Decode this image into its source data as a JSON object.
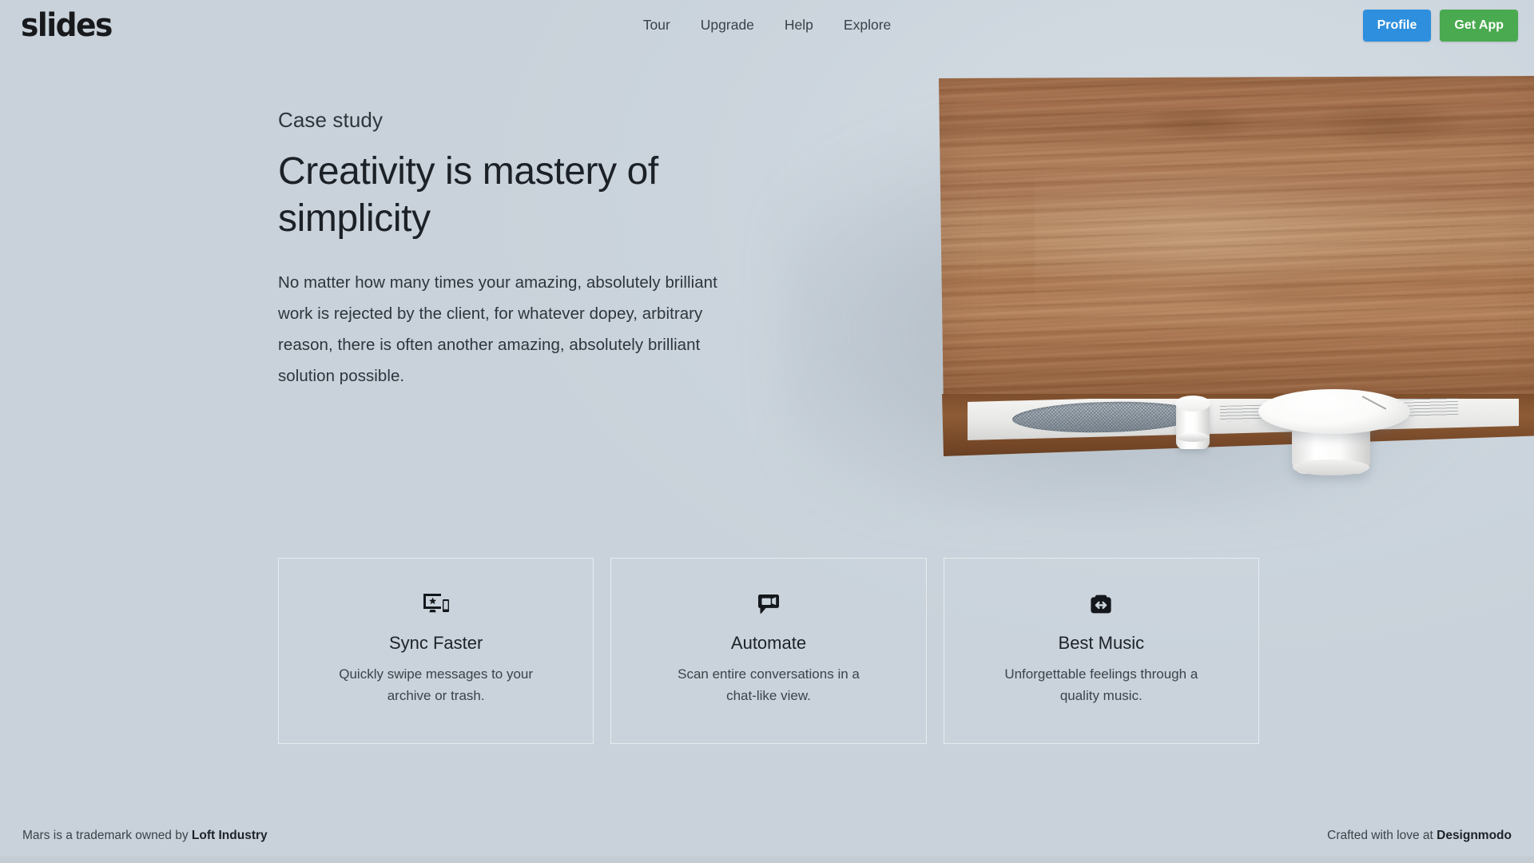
{
  "header": {
    "logo": "slides",
    "nav": [
      {
        "label": "Tour"
      },
      {
        "label": "Upgrade"
      },
      {
        "label": "Help"
      },
      {
        "label": "Explore"
      }
    ],
    "profile_button": "Profile",
    "getapp_button": "Get App",
    "colors": {
      "profile_blue": "#2d8fdd",
      "getapp_green": "#49aa4f"
    }
  },
  "hero": {
    "eyebrow": "Case study",
    "title": "Creativity is mastery of simplicity",
    "body": "No matter how many times your amazing, absolutely brilliant work is rejected by the client, for whatever dopey, arbitrary reason, there is often another amazing, absolutely brilliant solution possible.",
    "media": {
      "subject": "wooden-radio-speaker",
      "wood_color": "#a8744f",
      "grille_color": "#9aa3ab",
      "knob_color": "#ffffff"
    }
  },
  "features": [
    {
      "icon": "devices-star-icon",
      "title": "Sync Faster",
      "desc": "Quickly swipe messages to your archive or trash."
    },
    {
      "icon": "video-chat-bubble-icon",
      "title": "Automate",
      "desc": "Scan entire conversations in a chat-like view."
    },
    {
      "icon": "briefcase-arrows-icon",
      "title": "Best Music",
      "desc": "Unforgettable feelings through a quality music."
    }
  ],
  "footer": {
    "left_prefix": "Mars is a trademark owned by ",
    "left_strong": "Loft Industry",
    "right_prefix": "Crafted with love at ",
    "right_strong": "Designmodo"
  },
  "page": {
    "background_color": "#ccd5dd"
  }
}
